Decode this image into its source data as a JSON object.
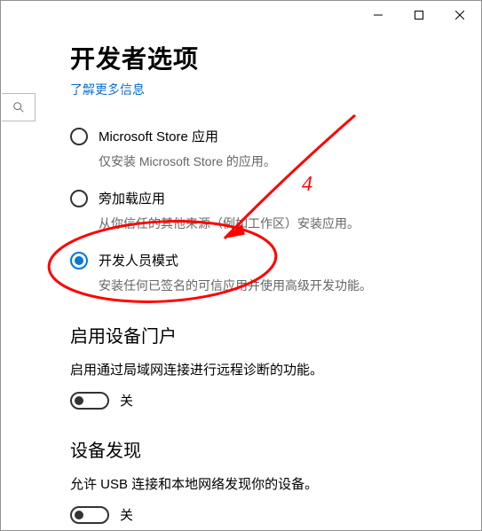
{
  "titlebar": {
    "minimize": "minimize",
    "maximize": "maximize",
    "close": "close"
  },
  "page_title": "开发者选项",
  "link_fragment": "了解更多信息",
  "options": [
    {
      "label": "Microsoft Store 应用",
      "desc": "仅安装 Microsoft Store 的应用。",
      "selected": false
    },
    {
      "label": "旁加载应用",
      "desc": "从你信任的其他来源（例如工作区）安装应用。",
      "selected": false
    },
    {
      "label": "开发人员模式",
      "desc": "安装任何已签名的可信应用并使用高级开发功能。",
      "selected": true
    }
  ],
  "sections": [
    {
      "title": "启用设备门户",
      "desc": "启用通过局域网连接进行远程诊断的功能。",
      "toggle_state": "关"
    },
    {
      "title": "设备发现",
      "desc": "允许 USB 连接和本地网络发现你的设备。",
      "toggle_state": "关"
    }
  ],
  "annotation": {
    "label": "4",
    "color": "#ff0000"
  }
}
